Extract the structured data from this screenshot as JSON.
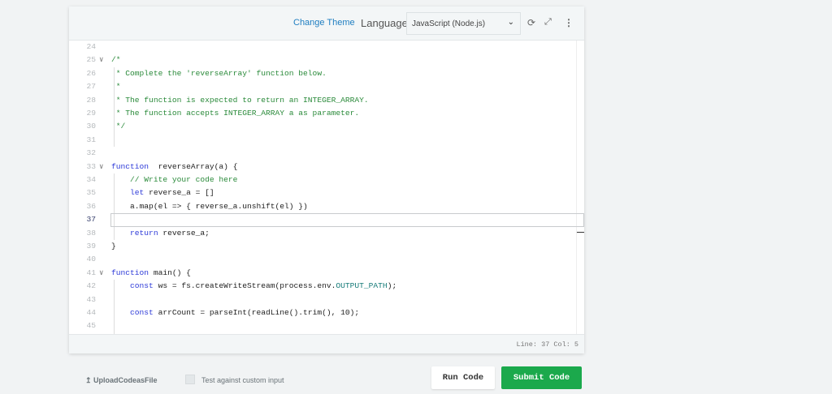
{
  "header": {
    "change_theme": "Change Theme",
    "language_label": "Language",
    "language_value": "JavaScript (Node.js)"
  },
  "editor": {
    "first_line": 24,
    "active_line": 37,
    "fold_lines": [
      25,
      33,
      41
    ],
    "lines": [
      [],
      [
        [
          "cm",
          "/*"
        ]
      ],
      [
        [
          "cm",
          " * Complete the 'reverseArray' function below."
        ]
      ],
      [
        [
          "cm",
          " *"
        ]
      ],
      [
        [
          "cm",
          " * The function is expected to return an INTEGER_ARRAY."
        ]
      ],
      [
        [
          "cm",
          " * The function accepts INTEGER_ARRAY a as parameter."
        ]
      ],
      [
        [
          "cm",
          " */"
        ]
      ],
      [],
      [],
      [
        [
          "kw",
          "function"
        ],
        [
          "",
          "  reverseArray(a) {"
        ]
      ],
      [
        [
          "cm",
          "    // Write your code here"
        ]
      ],
      [
        [
          "kw",
          "    let"
        ],
        [
          "",
          " reverse_a = []"
        ]
      ],
      [
        [
          "",
          "    a.map(el => { reverse_a.unshift(el) })"
        ]
      ],
      [],
      [
        [
          "kw",
          "    return"
        ],
        [
          "",
          " reverse_a;"
        ]
      ],
      [
        [
          "",
          "}"
        ]
      ],
      [],
      [
        [
          "kw",
          "function"
        ],
        [
          "",
          " main() {"
        ]
      ],
      [
        [
          "kw",
          "    const"
        ],
        [
          "",
          " ws = fs.createWriteStream(process.env."
        ],
        [
          "cn",
          "OUTPUT_PATH"
        ],
        [
          "",
          ");"
        ]
      ],
      [],
      [
        [
          "kw",
          "    const"
        ],
        [
          "",
          " arrCount = parseInt(readLine().trim(), 10);"
        ]
      ],
      []
    ]
  },
  "status": {
    "text": "Line: 37 Col: 5"
  },
  "footer": {
    "upload": "UploadCodeasFile",
    "custom_input": "Test against custom input",
    "run": "Run Code",
    "submit": "Submit Code"
  }
}
